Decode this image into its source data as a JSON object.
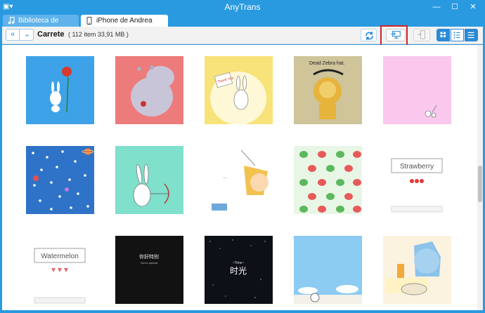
{
  "titlebar": {
    "title": "AnyTrans",
    "menu_glyph": "▣▾",
    "min": "—",
    "max": "☐",
    "close": "✕"
  },
  "tabs": [
    {
      "label": "Biblioteca de iTunes",
      "icon": "music-note-icon"
    },
    {
      "label": "iPhone de Andrea",
      "icon": "iphone-icon"
    }
  ],
  "toolbar": {
    "back": "«",
    "menu": "⌄",
    "breadcrumb": "Carrete",
    "info": "( 112 item 33,91 MB )"
  },
  "tiles": {
    "zebra_text": "Dead Zebra hat.",
    "strawberry": "Strawberry",
    "watermelon": "Watermelon",
    "t13_line1": "你好特别",
    "t13_line2": "You're special",
    "t14_small": "~Time~",
    "t14_big": "时光",
    "t3_sign": "Thank You"
  },
  "colors": {
    "accent": "#2a9ae0",
    "highlight": "#d0232a"
  }
}
